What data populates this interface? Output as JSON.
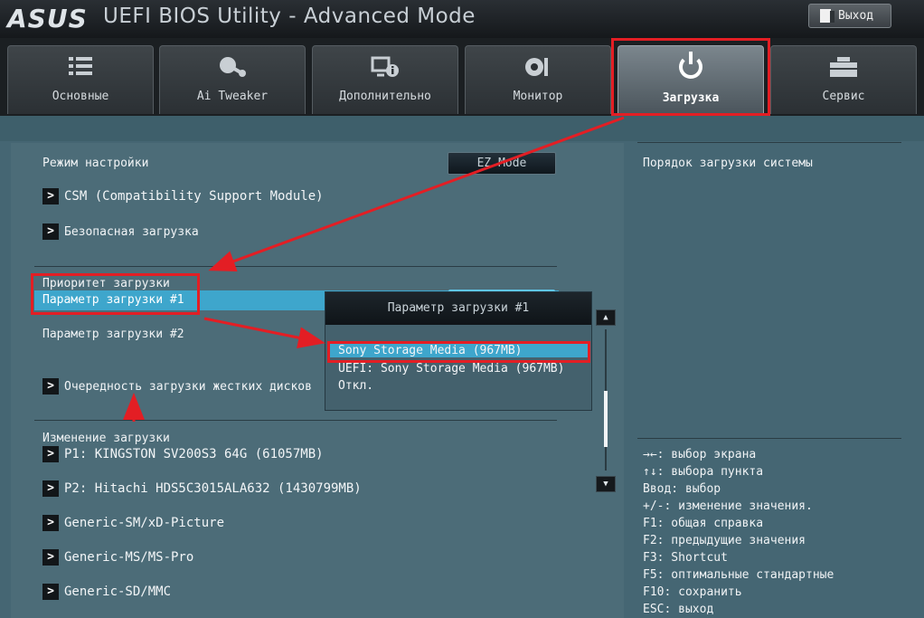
{
  "header": {
    "brand": "ASUS",
    "title": "UEFI BIOS Utility - Advanced Mode",
    "exit_label": "Выход"
  },
  "tabs": [
    {
      "label": "Основные",
      "icon": "list-icon",
      "active": false
    },
    {
      "label": "Ai Tweaker",
      "icon": "ai-tweaker-icon",
      "active": false
    },
    {
      "label": "Дополнительно",
      "icon": "advanced-info-icon",
      "active": false
    },
    {
      "label": "Монитор",
      "icon": "monitor-gauge-icon",
      "active": false
    },
    {
      "label": "Загрузка",
      "icon": "power-icon",
      "active": true
    },
    {
      "label": "Сервис",
      "icon": "toolbox-icon",
      "active": false
    }
  ],
  "main": {
    "setup_mode_label": "Режим настройки",
    "ez_mode_label": "EZ Mode",
    "csm_label": "CSM (Compatibility Support Module)",
    "secure_boot_label": "Безопасная загрузка",
    "boot_priority_heading": "Приоритет загрузки",
    "boot_option_1_label": "Параметр загрузки #1",
    "boot_option_2_label": "Параметр загрузки #2",
    "hdd_priority_label": "Очередность загрузки жестких дисков",
    "boot_override_heading": "Изменение загрузки",
    "boot_override_items": [
      "P1: KINGSTON SV200S3 64G   (61057MB)",
      "P2: Hitachi HDS5C3015ALA632   (1430799MB)",
      "Generic-SM/xD-Picture",
      "Generic-MS/MS-Pro",
      "Generic-SD/MMC"
    ]
  },
  "dropdown": {
    "title": "Параметр загрузки #1",
    "options": [
      "Sony Storage Media  (967MB)",
      "UEFI: Sony Storage Media (967MB)",
      "Откл."
    ],
    "selected_index": 0
  },
  "help": {
    "description": "Порядок загрузки системы",
    "keys": [
      "→←: выбор экрана",
      "↑↓: выбора пункта",
      "Ввод: выбор",
      "+/-: изменение значения.",
      "F1: общая справка",
      "F2: предыдущие значения",
      "F3: Shortcut",
      "F5: оптимальные стандартные",
      "F10: сохранить",
      "ESC: выход"
    ]
  },
  "colors": {
    "accent_highlight": "#3ea6cc",
    "annotation_red": "#e31e24",
    "panel_bg": "#4c6c78"
  }
}
